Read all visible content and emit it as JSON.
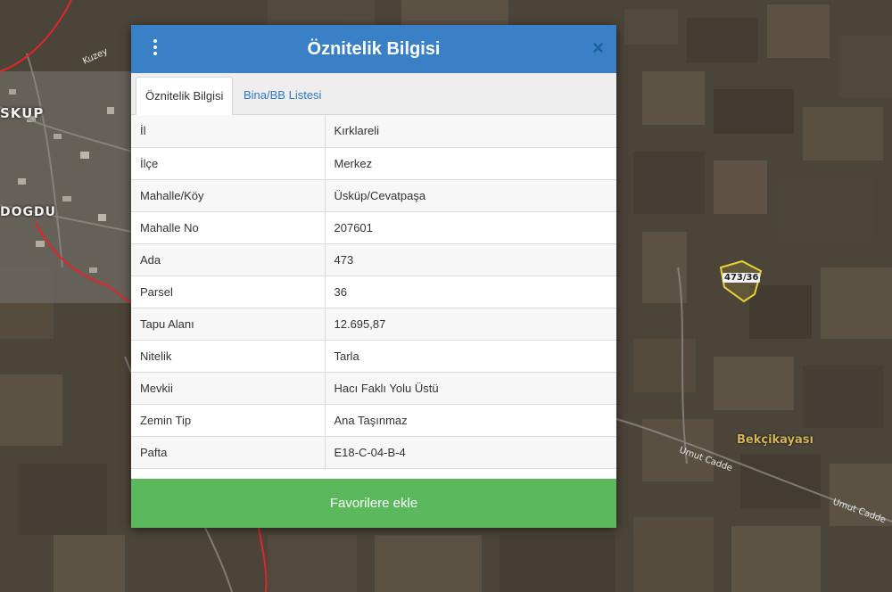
{
  "map": {
    "labels": {
      "town": "SKUP",
      "district": "DOGDU",
      "street_1": "Kuzey",
      "street_2": "Umut Cadde",
      "street_3": "Umut Cadde",
      "village": "Bekçikayası",
      "parcel": "473/36"
    }
  },
  "dialog": {
    "title": "Öznitelik Bilgisi",
    "close_symbol": "×",
    "tabs": [
      {
        "label": "Öznitelik Bilgisi",
        "active": true
      },
      {
        "label": "Bina/BB Listesi",
        "active": false
      }
    ],
    "rows": [
      {
        "key": "İl",
        "value": "Kırklareli"
      },
      {
        "key": "İlçe",
        "value": "Merkez"
      },
      {
        "key": "Mahalle/Köy",
        "value": "Üsküp/Cevatpaşa"
      },
      {
        "key": "Mahalle No",
        "value": "207601"
      },
      {
        "key": "Ada",
        "value": "473"
      },
      {
        "key": "Parsel",
        "value": "36"
      },
      {
        "key": "Tapu Alanı",
        "value": "12.695,87"
      },
      {
        "key": "Nitelik",
        "value": "Tarla"
      },
      {
        "key": "Mevkii",
        "value": "Hacı Faklı Yolu Üstü"
      },
      {
        "key": "Zemin Tip",
        "value": "Ana Taşınmaz"
      },
      {
        "key": "Pafta",
        "value": "E18-C-04-B-4"
      }
    ],
    "favorite_button": "Favorilere ekle"
  },
  "colors": {
    "header": "#3a80c6",
    "favorite": "#5cb85c",
    "tab_link": "#2f78c4",
    "parcel_outline": "#e8d13a",
    "boundary": "#e0262a"
  }
}
